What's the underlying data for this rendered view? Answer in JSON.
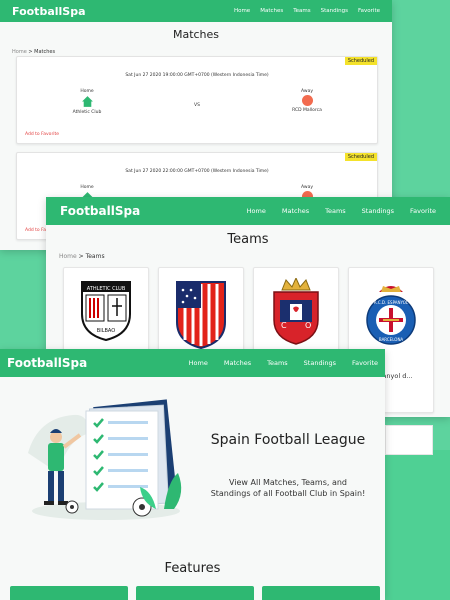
{
  "app": {
    "brand": "FootballSpa",
    "nav": [
      "Home",
      "Matches",
      "Teams",
      "Standings",
      "Favorite"
    ]
  },
  "matches_page": {
    "title": "Matches",
    "breadcrumb": {
      "home": "Home",
      "sep": ">",
      "current": "Matches"
    },
    "cards": [
      {
        "status": "Scheduled",
        "date": "Sat Jun 27 2020 19:00:00 GMT+0700 (Western Indonesia Time)",
        "home_label": "Home",
        "home_team": "Athletic Club",
        "vs": "VS",
        "away_label": "Away",
        "away_team": "RCD Mallorca",
        "favorite": "Add to Favorite"
      },
      {
        "status": "Scheduled",
        "date": "Sat Jun 27 2020 22:00:00 GMT+0700 (Western Indonesia Time)",
        "home_label": "Home",
        "home_team": "",
        "vs": "VS",
        "away_label": "Away",
        "away_team": "",
        "favorite": "Add to Favorite"
      }
    ]
  },
  "teams_page": {
    "title": "Teams",
    "breadcrumb": {
      "home": "Home",
      "sep": ">",
      "current": "Teams"
    },
    "teams": [
      {
        "name": "",
        "crest": "athletic-club-crest",
        "crest_text": "ATHLETIC CLUB",
        "crest_text2": "BILBAO"
      },
      {
        "name": "",
        "crest": "atletico-madrid-crest",
        "crest_text": "",
        "crest_text2": ""
      },
      {
        "name": "",
        "crest": "osasuna-crest",
        "crest_text": "",
        "crest_text2": ""
      },
      {
        "name": "RCD Espanyol d...",
        "crest": "espanyol-crest",
        "crest_text": "R.C.D. ESPANYOL",
        "crest_text2": "BARCELONA"
      }
    ]
  },
  "home_page": {
    "hero_title": "Spain Football League",
    "hero_subtitle": "View All Matches, Teams, and Standings of all Football Club in Spain!",
    "features_title": "Features"
  },
  "colors": {
    "primary": "#2eb872",
    "background": "#5dd39e",
    "badge": "#f4e22b",
    "favorite_link": "#e23c3c"
  }
}
